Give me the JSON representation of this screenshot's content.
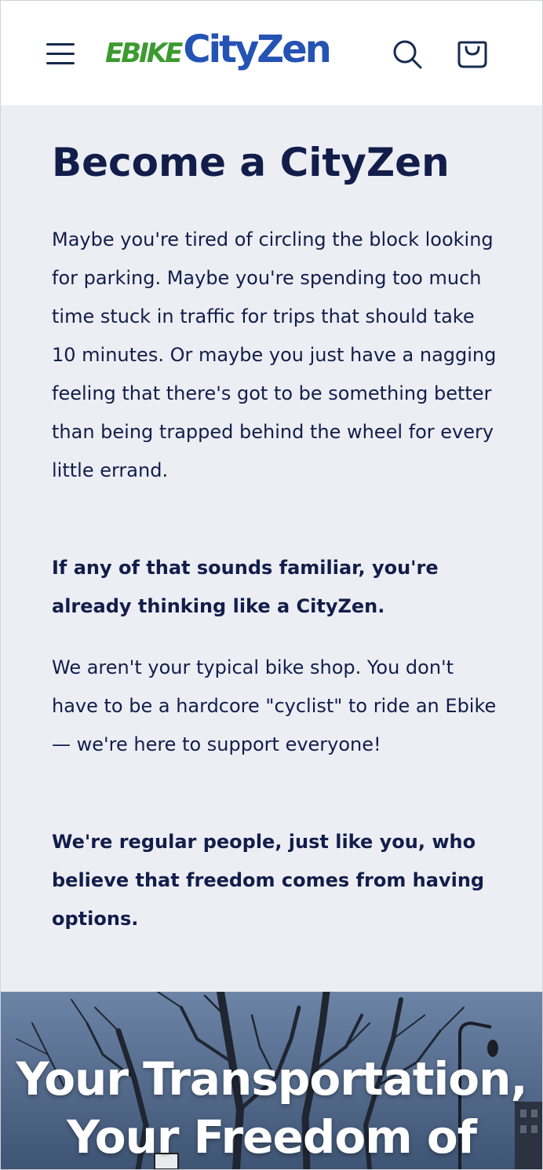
{
  "header": {
    "logo": {
      "brand_prefix": "EBIKE",
      "brand_name": "CityZen"
    },
    "icons": {
      "menu": "hamburger-menu-icon",
      "search": "search-icon",
      "cart": "shopping-bag-icon"
    }
  },
  "main": {
    "title": "Become a CityZen",
    "paragraphs": [
      {
        "text": "Maybe you're tired of circling the block looking for parking. Maybe you're spending too much time stuck in traffic for trips that should take 10 minutes. Or maybe you just have a nagging feeling that there's got to be something better than being trapped behind the wheel for every little errand.",
        "bold": false
      },
      {
        "text": "If any of that sounds familiar, you're already thinking like a CityZen.",
        "bold": true
      },
      {
        "text": "We aren't your typical bike shop. You don't have to be a hardcore \"cyclist\" to ride an Ebike — we're here to support everyone!",
        "bold": false
      },
      {
        "text": "We're regular people, just like you, who believe that freedom comes from having options.",
        "bold": true
      }
    ]
  },
  "hero": {
    "title_line_1": "Your Transportation,",
    "title_line_2": "Your Freedom of"
  },
  "colors": {
    "brand_green": "#3c9b2f",
    "brand_blue": "#2453b4",
    "text_navy": "#121d4a",
    "content_bg": "#eceef4"
  }
}
